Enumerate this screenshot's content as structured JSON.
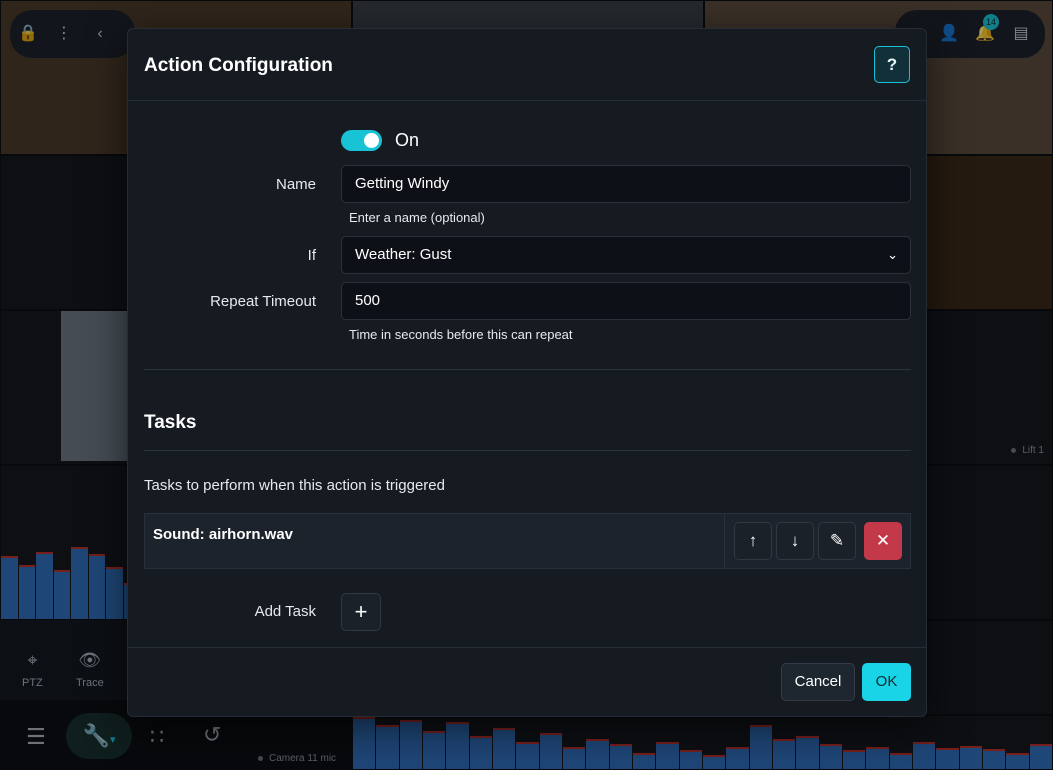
{
  "background": {
    "tiles": [
      {
        "name": "camera-tile-lift-1",
        "label": "Lift 1"
      },
      {
        "name": "camera-tile-camera-11-mic",
        "label": "Camera 11 mic"
      }
    ],
    "ptz_panel": {
      "ptz_label": "PTZ",
      "trace_label": "Trace"
    },
    "notification_count": "14"
  },
  "modal": {
    "title": "Action Configuration",
    "help_label": "?",
    "enabled_label": "On",
    "enabled": true,
    "name_field": {
      "label": "Name",
      "value": "Getting Windy",
      "hint": "Enter a name (optional)"
    },
    "if_field": {
      "label": "If",
      "value": "Weather: Gust"
    },
    "repeat_field": {
      "label": "Repeat Timeout",
      "value": "500",
      "hint": "Time in seconds before this can repeat"
    },
    "tasks": {
      "title": "Tasks",
      "description": "Tasks to perform when this action is triggered",
      "items": [
        {
          "label": "Sound: airhorn.wav"
        }
      ],
      "add_label": "Add Task"
    },
    "footer": {
      "cancel_label": "Cancel",
      "ok_label": "OK"
    }
  },
  "colors": {
    "accent": "#19c3d6",
    "danger": "#c4394a",
    "modal_bg": "#161b22"
  }
}
